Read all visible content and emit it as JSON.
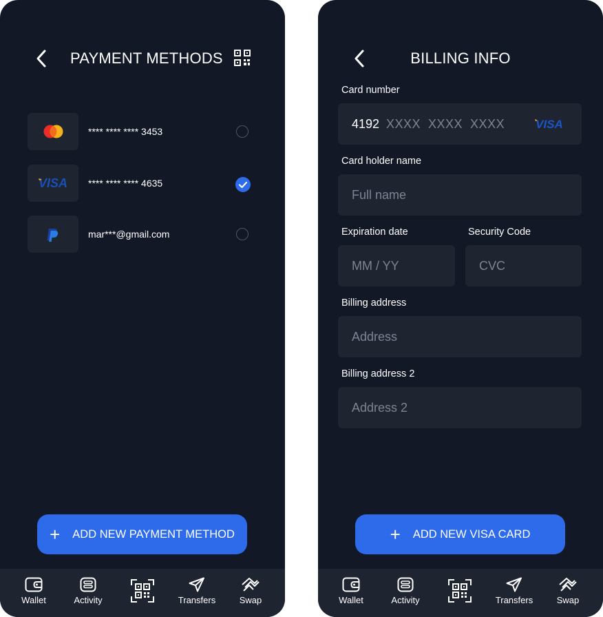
{
  "payment_methods_screen": {
    "title": "PAYMENT METHODS",
    "items": [
      {
        "logo": "mastercard-logo",
        "label": "**** **** **** 3453",
        "selected": false
      },
      {
        "logo": "visa-logo",
        "label": "**** **** **** 4635",
        "selected": true
      },
      {
        "logo": "paypal-logo",
        "label": "mar***@gmail.com",
        "selected": false
      }
    ],
    "cta_label": "ADD NEW PAYMENT METHOD"
  },
  "billing_screen": {
    "title": "BILLING INFO",
    "card_number_label": "Card number",
    "card_number_first": "4192",
    "card_number_rest": "XXXX  XXXX  XXXX",
    "card_brand": "VISA",
    "card_holder_label": "Card holder name",
    "card_holder_placeholder": "Full name",
    "expiration_label": "Expiration date",
    "expiration_placeholder": "MM / YY",
    "security_label": "Security Code",
    "security_placeholder": "CVC",
    "billing_address_label": "Billing address",
    "billing_address_placeholder": "Address",
    "billing_address2_label": "Billing address 2",
    "billing_address2_placeholder": "Address 2",
    "cta_label": "ADD NEW VISA CARD"
  },
  "tabbar": {
    "tabs": [
      {
        "label": "Wallet",
        "icon": "wallet-icon"
      },
      {
        "label": "Activity",
        "icon": "activity-icon"
      },
      {
        "label": "",
        "icon": "qr-scan-icon"
      },
      {
        "label": "Transfers",
        "icon": "send-icon"
      },
      {
        "label": "Swap",
        "icon": "swap-icon"
      }
    ]
  },
  "colors": {
    "background": "#131826",
    "surface": "#1f2431",
    "accent": "#2d6bea",
    "placeholder": "#7d8494"
  }
}
